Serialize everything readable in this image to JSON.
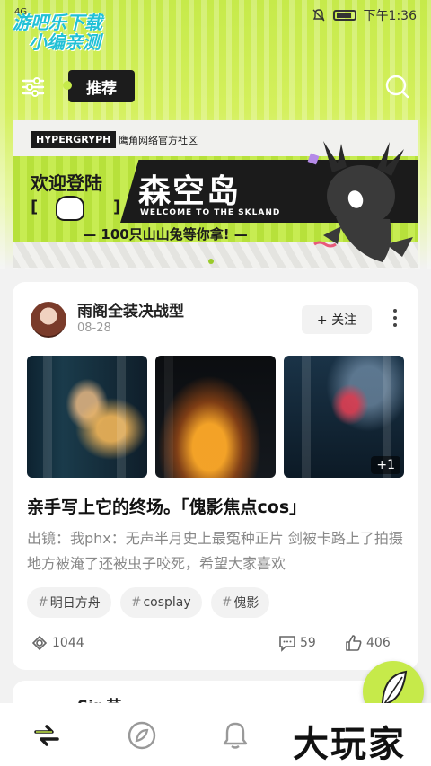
{
  "status_bar": {
    "network": "4G",
    "time": "下午1:36"
  },
  "watermark_top": {
    "line1": "游吧乐下载",
    "line2": "小编亲测"
  },
  "nav": {
    "active_tab": "推荐"
  },
  "banner": {
    "brand": "HYPERGRYPH",
    "brand_sub": "鹰角网络官方社区",
    "welcome": "欢迎登陆",
    "title": "森空岛",
    "title_en": "WELCOME TO THE SKLAND",
    "promo": "— 100只山山兔等你拿! —",
    "bracket_left": "[",
    "bracket_right": "]"
  },
  "post": {
    "author": "雨阁全装决战型",
    "date": "08-28",
    "follow_label": "+ 关注",
    "extra_photo_count": "+1",
    "title": "亲手写上它的终场。「傀影焦点cos」",
    "body": "出镜：我phx：无声半月史上最冤种正片 剑被卡路上了拍摄地方被淹了还被虫子咬死，希望大家喜欢",
    "tags": [
      {
        "hash": "#",
        "label": "明日方舟"
      },
      {
        "hash": "#",
        "label": "cosplay"
      },
      {
        "hash": "#",
        "label": "傀影"
      }
    ],
    "views": "1044",
    "comments": "59",
    "likes": "406"
  },
  "next_post": {
    "author_partial": "Sir 芸"
  },
  "watermark_bottom": "大玩家",
  "colors": {
    "accent_green": "#c6ea4a",
    "dark": "#1b1b1b"
  }
}
